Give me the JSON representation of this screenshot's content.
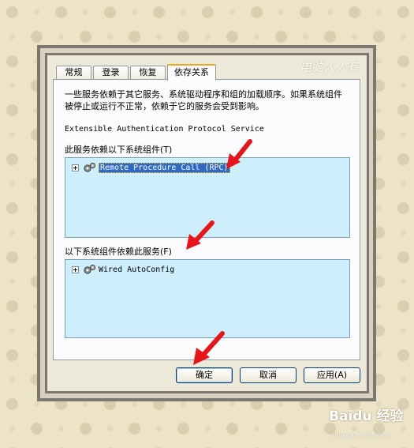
{
  "tabs": [
    {
      "label": "常规",
      "active": false
    },
    {
      "label": "登录",
      "active": false
    },
    {
      "label": "恢复",
      "active": false
    },
    {
      "label": "依存关系",
      "active": true
    }
  ],
  "watermark": "电脑人人有",
  "description": "一些服务依赖于其它服务、系统驱动程序和组的加载顺序。如果系统组件被停止或运行不正常，依赖于它的服务会受到影响。",
  "service_name": "Extensible Authentication Protocol Service",
  "depends_on": {
    "label": "此服务依赖以下系统组件(T)",
    "items": [
      {
        "text": "Remote Procedure Call (RPC)",
        "selected": true
      }
    ]
  },
  "dependents": {
    "label": "以下系统组件依赖此服务(F)",
    "items": [
      {
        "text": "Wired AutoConfig",
        "selected": false
      }
    ]
  },
  "buttons": {
    "ok": "确定",
    "cancel": "取消",
    "apply": "应用(A)"
  },
  "brand": {
    "logo_text": "Baidu 经验",
    "url": "jingyan.baidu.com"
  },
  "colors": {
    "arrow": "#e8141a",
    "selection": "#316ac5",
    "tree_bg": "#cdeffb",
    "active_tab_accent": "#f5a623"
  }
}
